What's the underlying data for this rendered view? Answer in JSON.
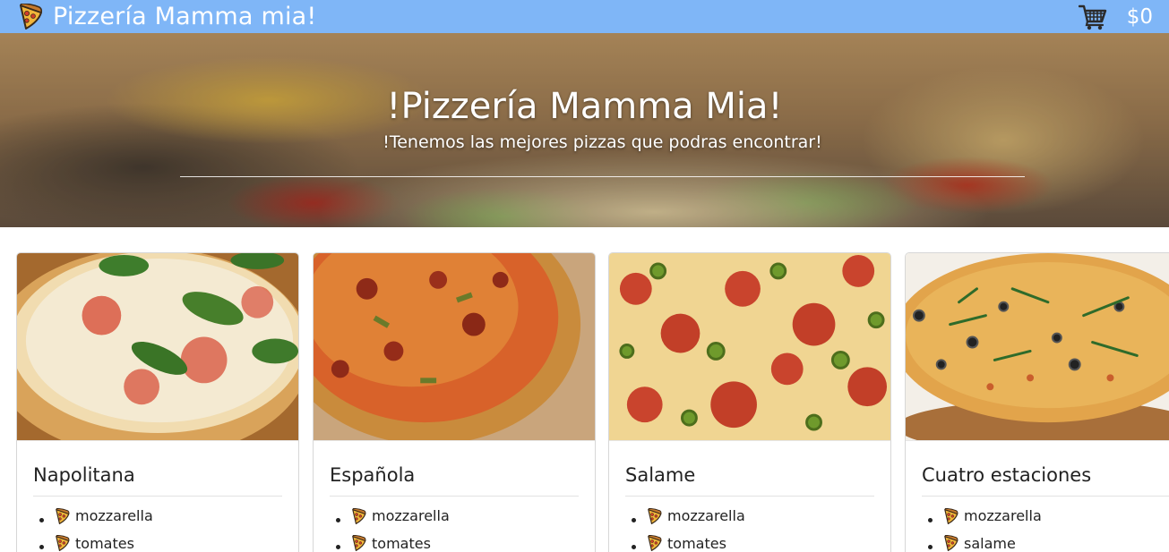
{
  "navbar": {
    "brand_icon": "pizza-slice-icon",
    "title": "Pizzería Mamma mia!",
    "cart_icon": "shopping-cart-icon",
    "cart_total": "$0",
    "background_color": "#7fb6f7"
  },
  "hero": {
    "title": "!Pizzería Mamma Mia!",
    "subtitle": "!Tenemos las mejores pizzas que podras encontrar!"
  },
  "pizzas": [
    {
      "name": "Napolitana",
      "ingredients": [
        "mozzarella",
        "tomates"
      ]
    },
    {
      "name": "Española",
      "ingredients": [
        "mozzarella",
        "tomates"
      ]
    },
    {
      "name": "Salame",
      "ingredients": [
        "mozzarella",
        "tomates"
      ]
    },
    {
      "name": "Cuatro estaciones",
      "ingredients": [
        "mozzarella",
        "salame"
      ]
    }
  ],
  "ingredient_icon": "pizza-slice-icon"
}
